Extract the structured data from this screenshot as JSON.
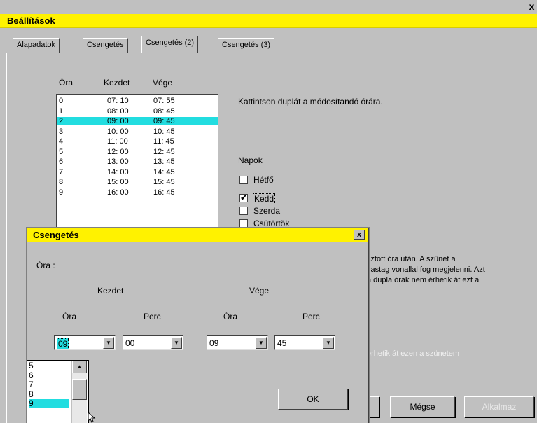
{
  "window": {
    "title": "Beállítások",
    "close": "x"
  },
  "tabs": [
    {
      "label": "Alapadatok"
    },
    {
      "label": "Csengetés"
    },
    {
      "label": "Csengetés (2)",
      "active": true
    },
    {
      "label": "Csengetés (3)"
    }
  ],
  "schedule": {
    "headers": {
      "ora": "Óra",
      "kezdet": "Kezdet",
      "vege": "Vége"
    },
    "rows": [
      {
        "ora": "0",
        "kezdet": "07: 10",
        "vege": "07: 55"
      },
      {
        "ora": "1",
        "kezdet": "08: 00",
        "vege": "08: 45"
      },
      {
        "ora": "2",
        "kezdet": "09: 00",
        "vege": "09: 45",
        "selected": true
      },
      {
        "ora": "3",
        "kezdet": "10: 00",
        "vege": "10: 45"
      },
      {
        "ora": "4",
        "kezdet": "11: 00",
        "vege": "11: 45"
      },
      {
        "ora": "5",
        "kezdet": "12: 00",
        "vege": "12: 45"
      },
      {
        "ora": "6",
        "kezdet": "13: 00",
        "vege": "13: 45"
      },
      {
        "ora": "7",
        "kezdet": "14: 00",
        "vege": "14: 45"
      },
      {
        "ora": "8",
        "kezdet": "15: 00",
        "vege": "15: 45"
      },
      {
        "ora": "9",
        "kezdet": "16: 00",
        "vege": "16: 45"
      }
    ]
  },
  "hint": "Kattintson duplát a módosítandó órára.",
  "days": {
    "label": "Napok",
    "items": [
      {
        "label": "Hétfő",
        "checked": false
      },
      {
        "label": "Kedd",
        "checked": true
      },
      {
        "label": "Szerda",
        "checked": false
      },
      {
        "label": "Csütörtök",
        "checked": false
      }
    ]
  },
  "description": {
    "line1": "sztott óra után. A szünet a",
    "line2": "vastag vonallal fog megjelenni. Azt",
    "line3": "a dupla órák nem érhetik át ezt a"
  },
  "faded_text": "érhetik át ezen a szünetem",
  "main_buttons": {
    "megse": "Mégse",
    "alkalmaz": "Alkalmaz"
  },
  "dialog": {
    "title": "Csengetés",
    "close": "x",
    "ora_label": "Óra :",
    "kezdet": "Kezdet",
    "vege": "Vége",
    "kezdet_ora_label": "Óra",
    "kezdet_perc_label": "Perc",
    "vege_ora_label": "Óra",
    "vege_perc_label": "Perc",
    "kezdet_ora_value": "09",
    "kezdet_perc_value": "00",
    "vege_ora_value": "09",
    "vege_perc_value": "45",
    "ok": "OK",
    "dropdown_options": [
      "5",
      "6",
      "7",
      "8",
      "9"
    ],
    "dropdown_selected": "9"
  },
  "colors": {
    "title_bar": "#fff200",
    "selection": "#22dde0",
    "face": "#c0c0c0"
  }
}
